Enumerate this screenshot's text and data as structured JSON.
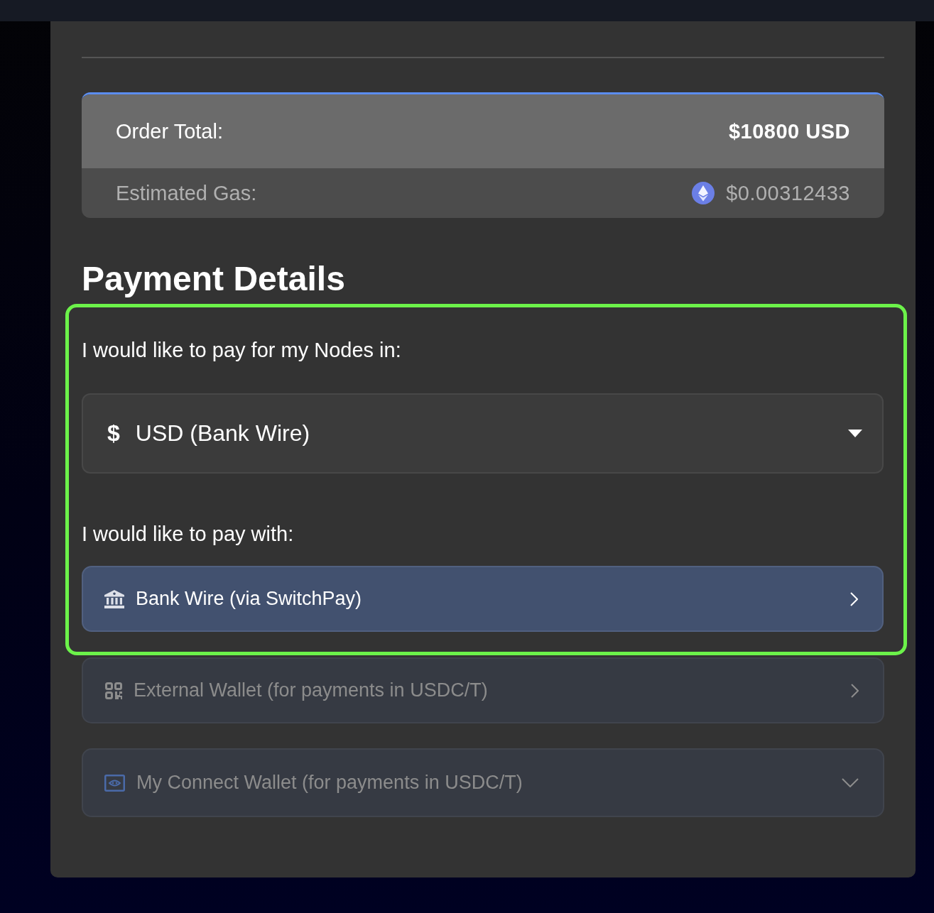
{
  "summary": {
    "rows": [
      {
        "kind": "total",
        "label": "Order Total:",
        "value": "$10800 USD"
      },
      {
        "kind": "gas",
        "label": "Estimated Gas:",
        "value": "$0.00312433"
      }
    ]
  },
  "payment": {
    "title": "Payment Details",
    "currency_prompt": "I would like to pay for my Nodes in:",
    "currency_select": {
      "symbol": "$",
      "value": "USD (Bank Wire)"
    },
    "method_prompt": "I would like to pay with:",
    "methods": [
      {
        "kind": "bank",
        "label": "Bank Wire (via SwitchPay)",
        "selected": true
      },
      {
        "kind": "qr",
        "label": "External Wallet (for payments in USDC/T)",
        "selected": false
      },
      {
        "kind": "connect",
        "label": "My Connect Wallet (for payments in USDC/T)",
        "selected": false
      }
    ]
  }
}
